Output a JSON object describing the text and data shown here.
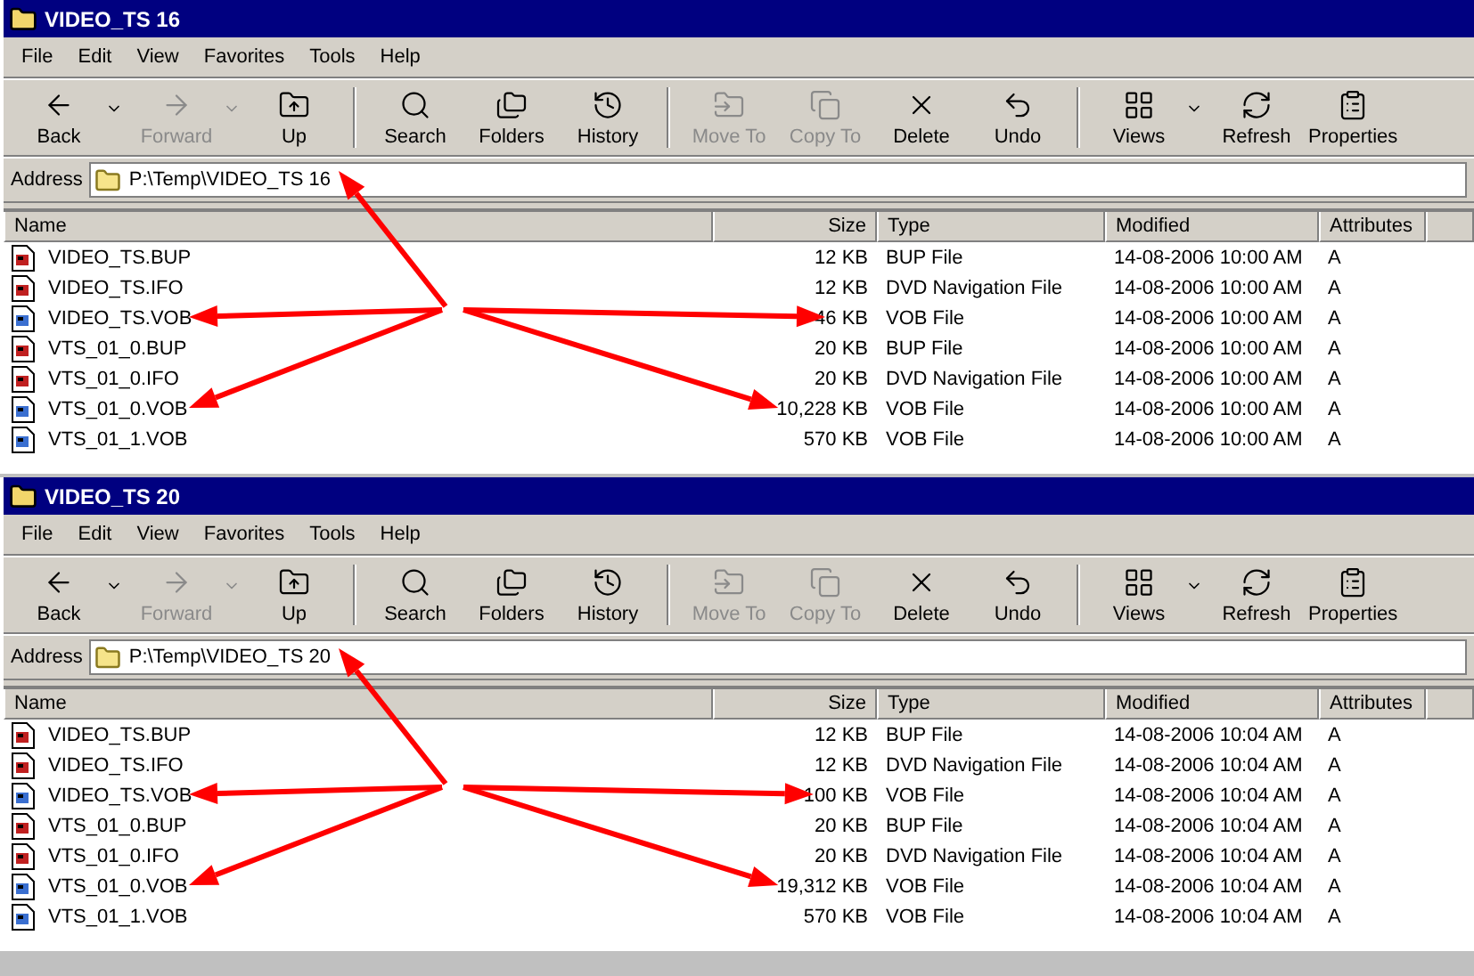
{
  "windows": [
    {
      "title": "VIDEO_TS 16",
      "menu": [
        {
          "label": "File"
        },
        {
          "label": "Edit"
        },
        {
          "label": "View"
        },
        {
          "label": "Favorites"
        },
        {
          "label": "Tools"
        },
        {
          "label": "Help"
        }
      ],
      "toolbar": [
        {
          "kind": "button",
          "label": "Back",
          "disabled": false,
          "dropdown": true
        },
        {
          "kind": "button",
          "label": "Forward",
          "disabled": true,
          "dropdown": true
        },
        {
          "kind": "button",
          "label": "Up",
          "disabled": false
        },
        {
          "kind": "separator"
        },
        {
          "kind": "button",
          "label": "Search",
          "disabled": false
        },
        {
          "kind": "button",
          "label": "Folders",
          "disabled": false
        },
        {
          "kind": "button",
          "label": "History",
          "disabled": false
        },
        {
          "kind": "separator"
        },
        {
          "kind": "button",
          "label": "Move To",
          "disabled": true
        },
        {
          "kind": "button",
          "label": "Copy To",
          "disabled": true
        },
        {
          "kind": "button",
          "label": "Delete",
          "disabled": false
        },
        {
          "kind": "button",
          "label": "Undo",
          "disabled": false
        },
        {
          "kind": "separator"
        },
        {
          "kind": "button",
          "label": "Views",
          "disabled": false,
          "dropdown": true
        },
        {
          "kind": "button",
          "label": "Refresh",
          "disabled": false
        },
        {
          "kind": "button",
          "label": "Properties",
          "disabled": false
        }
      ],
      "address_label": "Address",
      "address": "P:\\Temp\\VIDEO_TS 16",
      "address_arrow": true,
      "columns": [
        "Name",
        "Size",
        "Type",
        "Modified",
        "Attributes"
      ],
      "rows": [
        {
          "name": "VIDEO_TS.BUP",
          "size": "12 KB",
          "type": "BUP File",
          "modified": "14-08-2006 10:00 AM",
          "attributes": "A",
          "kind": "data"
        },
        {
          "name": "VIDEO_TS.IFO",
          "size": "12 KB",
          "type": "DVD Navigation File",
          "modified": "14-08-2006 10:00 AM",
          "attributes": "A",
          "kind": "data"
        },
        {
          "name": "VIDEO_TS.VOB",
          "size": "46 KB",
          "type": "VOB File",
          "modified": "14-08-2006 10:00 AM",
          "attributes": "A",
          "kind": "video",
          "arrow_to_name": true,
          "arrow_to_size": true
        },
        {
          "name": "VTS_01_0.BUP",
          "size": "20 KB",
          "type": "BUP File",
          "modified": "14-08-2006 10:00 AM",
          "attributes": "A",
          "kind": "data"
        },
        {
          "name": "VTS_01_0.IFO",
          "size": "20 KB",
          "type": "DVD Navigation File",
          "modified": "14-08-2006 10:00 AM",
          "attributes": "A",
          "kind": "data"
        },
        {
          "name": "VTS_01_0.VOB",
          "size": "10,228 KB",
          "type": "VOB File",
          "modified": "14-08-2006 10:00 AM",
          "attributes": "A",
          "kind": "video",
          "arrow_to_name": true,
          "arrow_to_size": true
        },
        {
          "name": "VTS_01_1.VOB",
          "size": "570 KB",
          "type": "VOB File",
          "modified": "14-08-2006 10:00 AM",
          "attributes": "A",
          "kind": "video"
        }
      ]
    },
    {
      "title": "VIDEO_TS 20",
      "menu": [
        {
          "label": "File"
        },
        {
          "label": "Edit"
        },
        {
          "label": "View"
        },
        {
          "label": "Favorites"
        },
        {
          "label": "Tools"
        },
        {
          "label": "Help"
        }
      ],
      "toolbar": [
        {
          "kind": "button",
          "label": "Back",
          "disabled": false,
          "dropdown": true
        },
        {
          "kind": "button",
          "label": "Forward",
          "disabled": true,
          "dropdown": true
        },
        {
          "kind": "button",
          "label": "Up",
          "disabled": false
        },
        {
          "kind": "separator"
        },
        {
          "kind": "button",
          "label": "Search",
          "disabled": false
        },
        {
          "kind": "button",
          "label": "Folders",
          "disabled": false
        },
        {
          "kind": "button",
          "label": "History",
          "disabled": false
        },
        {
          "kind": "separator"
        },
        {
          "kind": "button",
          "label": "Move To",
          "disabled": true
        },
        {
          "kind": "button",
          "label": "Copy To",
          "disabled": true
        },
        {
          "kind": "button",
          "label": "Delete",
          "disabled": false
        },
        {
          "kind": "button",
          "label": "Undo",
          "disabled": false
        },
        {
          "kind": "separator"
        },
        {
          "kind": "button",
          "label": "Views",
          "disabled": false,
          "dropdown": true
        },
        {
          "kind": "button",
          "label": "Refresh",
          "disabled": false
        },
        {
          "kind": "button",
          "label": "Properties",
          "disabled": false
        }
      ],
      "address_label": "Address",
      "address": "P:\\Temp\\VIDEO_TS 20",
      "address_arrow": true,
      "columns": [
        "Name",
        "Size",
        "Type",
        "Modified",
        "Attributes"
      ],
      "rows": [
        {
          "name": "VIDEO_TS.BUP",
          "size": "12 KB",
          "type": "BUP File",
          "modified": "14-08-2006 10:04 AM",
          "attributes": "A",
          "kind": "data"
        },
        {
          "name": "VIDEO_TS.IFO",
          "size": "12 KB",
          "type": "DVD Navigation File",
          "modified": "14-08-2006 10:04 AM",
          "attributes": "A",
          "kind": "data"
        },
        {
          "name": "VIDEO_TS.VOB",
          "size": "100 KB",
          "type": "VOB File",
          "modified": "14-08-2006 10:04 AM",
          "attributes": "A",
          "kind": "video",
          "arrow_to_name": true,
          "arrow_to_size": true
        },
        {
          "name": "VTS_01_0.BUP",
          "size": "20 KB",
          "type": "BUP File",
          "modified": "14-08-2006 10:04 AM",
          "attributes": "A",
          "kind": "data"
        },
        {
          "name": "VTS_01_0.IFO",
          "size": "20 KB",
          "type": "DVD Navigation File",
          "modified": "14-08-2006 10:04 AM",
          "attributes": "A",
          "kind": "data"
        },
        {
          "name": "VTS_01_0.VOB",
          "size": "19,312 KB",
          "type": "VOB File",
          "modified": "14-08-2006 10:04 AM",
          "attributes": "A",
          "kind": "video",
          "arrow_to_name": true,
          "arrow_to_size": true
        },
        {
          "name": "VTS_01_1.VOB",
          "size": "570 KB",
          "type": "VOB File",
          "modified": "14-08-2006 10:04 AM",
          "attributes": "A",
          "kind": "video"
        }
      ]
    }
  ]
}
